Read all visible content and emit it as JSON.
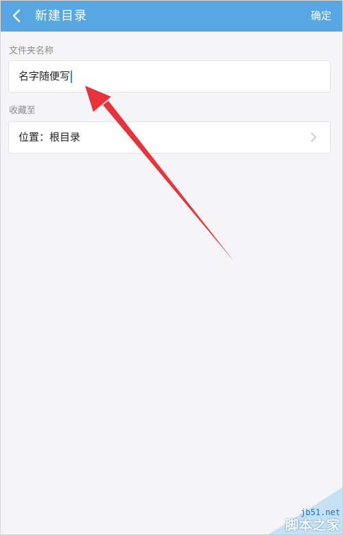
{
  "header": {
    "back_icon": "chevron-left-icon",
    "title": "新建目录",
    "confirm_label": "确定",
    "background_color": "#57a8e2",
    "text_color": "#ffffff"
  },
  "form": {
    "name_label": "文件夹名称",
    "name_value": "名字随便写",
    "save_label": "收藏至",
    "location_text": "位置：根目录",
    "location_chevron_icon": "chevron-right-icon"
  },
  "annotation": {
    "arrow_color": "#e8333a",
    "arrow_icon": "red-arrow-icon"
  },
  "watermark": {
    "url": "jb51.net",
    "name": "脚本之家"
  }
}
